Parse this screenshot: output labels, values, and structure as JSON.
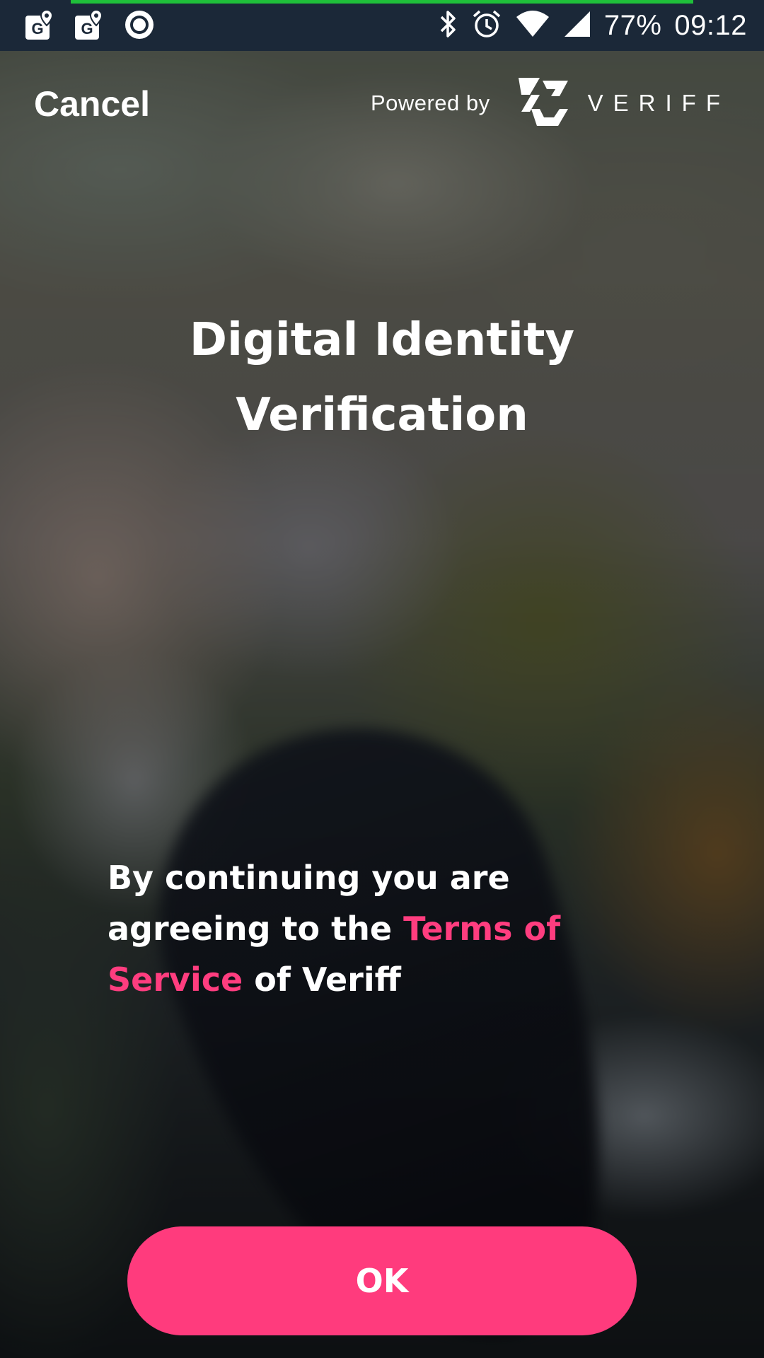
{
  "status_bar": {
    "icons": [
      "maps-g-icon",
      "maps-g-icon",
      "record-icon",
      "bluetooth-icon",
      "alarm-icon",
      "wifi-icon",
      "signal-icon"
    ],
    "battery": "77%",
    "time": "09:12",
    "progress_color": "#1fbf3a"
  },
  "header": {
    "cancel_label": "Cancel",
    "powered_by_label": "Powered by",
    "brand_name": "VERIFF"
  },
  "main": {
    "title_line1": "Digital Identity",
    "title_line2": "Verification",
    "agreement_prefix": "By continuing you are agreeing to the",
    "terms_link": "Terms of Service",
    "agreement_suffix": "of Veriff"
  },
  "actions": {
    "ok_label": "OK"
  },
  "colors": {
    "accent": "#ff3b7d",
    "status_bar_bg": "#1b2838",
    "text": "#ffffff"
  }
}
